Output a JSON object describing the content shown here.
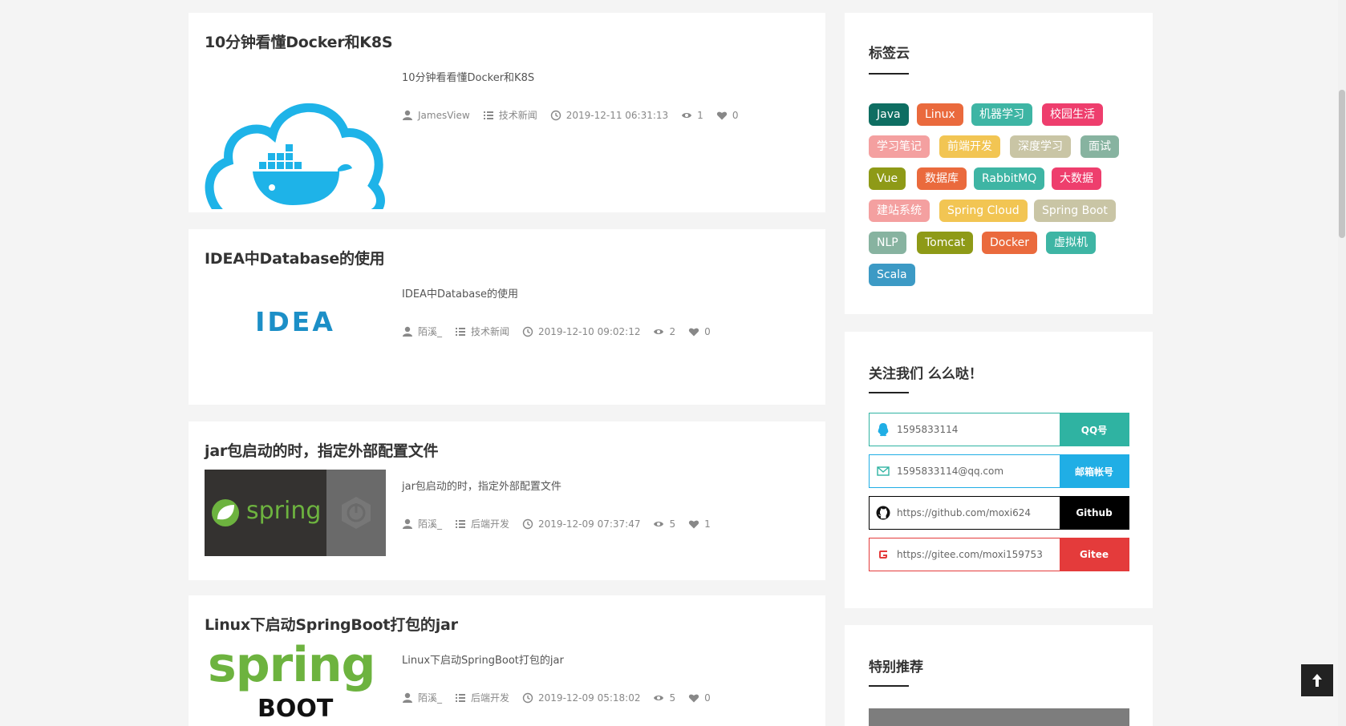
{
  "posts": [
    {
      "title": "10分钟看懂Docker和K8S",
      "excerpt": "10分钟看看懂Docker和K8S",
      "author": "JamesView",
      "category": "技术新闻",
      "date": "2019-12-11 06:31:13",
      "views": "1",
      "likes": "0",
      "thumb": "docker-logo"
    },
    {
      "title": "IDEA中Database的使用",
      "excerpt": "IDEA中Database的使用",
      "author": "陌溪_",
      "category": "技术新闻",
      "date": "2019-12-10 09:02:12",
      "views": "2",
      "likes": "0",
      "thumb": "idea-logo",
      "thumb_text": "IDEA"
    },
    {
      "title": "jar包启动的时，指定外部配置文件",
      "excerpt": "jar包启动的时，指定外部配置文件",
      "author": "陌溪_",
      "category": "后端开发",
      "date": "2019-12-09 07:37:47",
      "views": "5",
      "likes": "1",
      "thumb": "spring-logo",
      "thumb_text": "spring"
    },
    {
      "title": "Linux下启动SpringBoot打包的jar",
      "excerpt": "Linux下启动SpringBoot打包的jar",
      "author": "陌溪_",
      "category": "后端开发",
      "date": "2019-12-09 05:18:02",
      "views": "5",
      "likes": "0",
      "thumb": "spring-boot-logo",
      "thumb_text_1": "spring",
      "thumb_text_2": "BOOT"
    }
  ],
  "tag_cloud": {
    "title": "标签云",
    "tags": [
      {
        "label": "Java",
        "color": "#0e6e62"
      },
      {
        "label": "Linux",
        "color": "#ea6a3d"
      },
      {
        "label": "机器学习",
        "color": "#3eb5a4"
      },
      {
        "label": "校园生活",
        "color": "#ee3e6d"
      },
      {
        "label": "学习笔记",
        "color": "#f4a0a0"
      },
      {
        "label": "前端开发",
        "color": "#f2c553"
      },
      {
        "label": "深度学习",
        "color": "#c9c5a5"
      },
      {
        "label": "面试",
        "color": "#87b3a0"
      },
      {
        "label": "Vue",
        "color": "#8e9a17"
      },
      {
        "label": "数据库",
        "color": "#ea6a3d"
      },
      {
        "label": "RabbitMQ",
        "color": "#3eb5a4"
      },
      {
        "label": "大数据",
        "color": "#ee3e6d"
      },
      {
        "label": "建站系统",
        "color": "#f4a0a0"
      },
      {
        "label": "Spring Cloud",
        "color": "#f2c553"
      },
      {
        "label": "Spring Boot",
        "color": "#c9c5a5"
      },
      {
        "label": "NLP",
        "color": "#87b3a0"
      },
      {
        "label": "Tomcat",
        "color": "#8e9a17"
      },
      {
        "label": "Docker",
        "color": "#ea6a3d"
      },
      {
        "label": "虚拟机",
        "color": "#3eb5a4"
      },
      {
        "label": "Scala",
        "color": "#3c9ac5"
      }
    ]
  },
  "follow": {
    "title": "关注我们 么么哒！",
    "rows": [
      {
        "icon": "qq-icon",
        "value": "1595833114",
        "button": "QQ号",
        "color": "#2fb3a2"
      },
      {
        "icon": "mail-icon",
        "value": "1595833114@qq.com",
        "button": "邮箱帐号",
        "color": "#20aee5"
      },
      {
        "icon": "github-icon",
        "value": "https://github.com/moxi624",
        "button": "Github",
        "color": "#000000"
      },
      {
        "icon": "gitee-icon",
        "value": "https://gitee.com/moxi159753",
        "button": "Gitee",
        "color": "#e43b3b"
      }
    ]
  },
  "recommend": {
    "title": "特别推荐"
  }
}
